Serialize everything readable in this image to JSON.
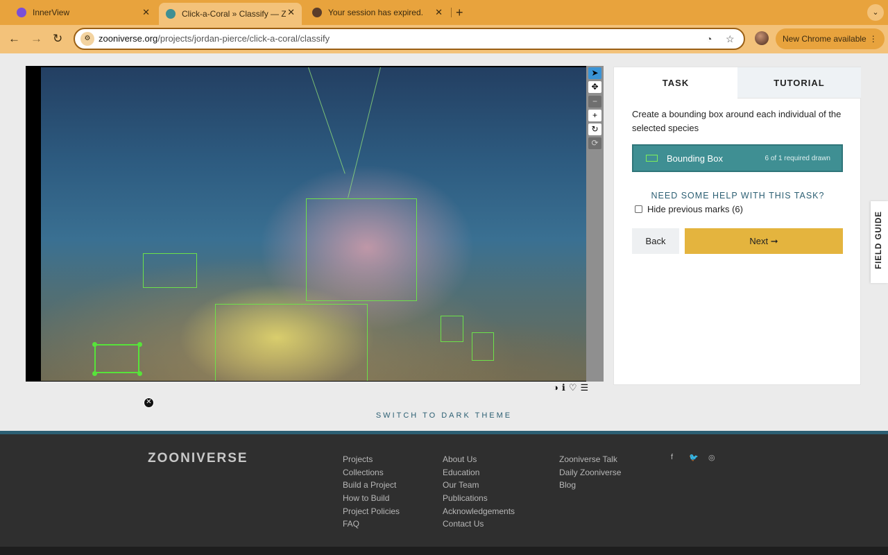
{
  "browser": {
    "tabs": [
      {
        "title": "InnerView",
        "active": false
      },
      {
        "title": "Click-a-Coral » Classify — Zo",
        "active": true
      },
      {
        "title": "Your session has expired.",
        "active": false
      }
    ],
    "close_glyph": "✕",
    "new_tab_glyph": "+",
    "tab_menu_glyph": "⌄",
    "back_glyph": "←",
    "forward_glyph": "→",
    "reload_glyph": "↻",
    "url_host": "zooniverse.org",
    "url_path": "/projects/jordan-pierce/click-a-coral/classify",
    "site_info_icon": "tune-icon",
    "performance_icon": "gauge-icon",
    "bookmark_glyph": "☆",
    "update_label": "New Chrome available",
    "update_menu_glyph": "⋮"
  },
  "viewer": {
    "tools": [
      {
        "name": "pointer",
        "glyph": "➤",
        "active": true
      },
      {
        "name": "move",
        "glyph": "✥"
      },
      {
        "name": "zoom-out",
        "glyph": "−"
      },
      {
        "name": "zoom-in",
        "glyph": "+"
      },
      {
        "name": "rotate",
        "glyph": "↻"
      },
      {
        "name": "reset",
        "glyph": "⟳"
      }
    ],
    "delete_glyph": "✕",
    "image_controls": [
      {
        "name": "invert",
        "glyph": "◑"
      },
      {
        "name": "metadata",
        "glyph": "ℹ"
      },
      {
        "name": "favorite",
        "glyph": "♡"
      },
      {
        "name": "collections",
        "glyph": "☰"
      }
    ]
  },
  "task_panel": {
    "tab_task": "TASK",
    "tab_tutorial": "TUTORIAL",
    "instruction": "Create a bounding box around each individual of the selected species",
    "tool_label": "Bounding Box",
    "tool_count": "6 of 1 required drawn",
    "tool_color": "#3f8f93",
    "help_text": "NEED SOME HELP WITH THIS TASK?",
    "hide_marks_label": "Hide previous marks (6)",
    "hide_marks_checked": false,
    "back_label": "Back",
    "next_label": "Next ➞",
    "next_color": "#e4b43e"
  },
  "field_guide": "FIELD GUIDE",
  "switch_theme": "SWITCH TO DARK THEME",
  "footer": {
    "logo": "ZOONIVERSE",
    "col1": [
      "Projects",
      "Collections",
      "Build a Project",
      "How to Build",
      "Project Policies",
      "FAQ"
    ],
    "col2": [
      "About Us",
      "Education",
      "Our Team",
      "Publications",
      "Acknowledgements",
      "Contact Us"
    ],
    "col3": [
      "Zooniverse Talk",
      "Daily Zooniverse",
      "Blog"
    ],
    "social": [
      {
        "name": "facebook",
        "glyph": "f"
      },
      {
        "name": "twitter",
        "glyph": "🐦"
      },
      {
        "name": "instagram",
        "glyph": "◎"
      }
    ]
  }
}
